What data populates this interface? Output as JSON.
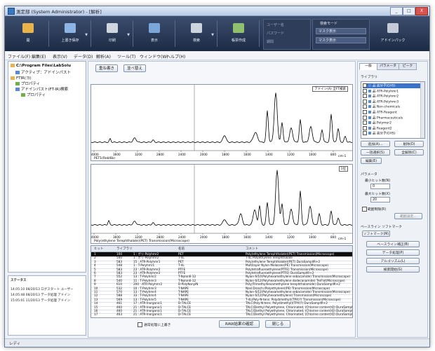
{
  "window": {
    "title": "測定部 (System Administrator) - [解析]",
    "minimize": "_",
    "maximize": "□",
    "close": "X"
  },
  "ribbon": {
    "buttons": [
      {
        "label": "開",
        "color": "#e8b34a",
        "icon": "folder-icon"
      },
      {
        "label": "上書き保存",
        "color": "#8db4e2",
        "icon": "save-icon"
      },
      {
        "label": "印刷",
        "color": "#cfd6e0",
        "icon": "print-icon"
      },
      {
        "label": "表示",
        "color": "#7aa6da",
        "icon": "view-icon"
      },
      {
        "label": "検索",
        "color": "#cdd4de",
        "icon": "search-icon"
      },
      {
        "label": "帳票作成",
        "color": "#8fc06e",
        "icon": "report-icon"
      }
    ],
    "panel1": {
      "line1": "ユーザー名",
      "line2": "パスワード",
      "line3": "期間"
    },
    "panel2": {
      "title": "検索モード",
      "drop1": "マスク表示",
      "drop2": "マスク表示"
    },
    "last": {
      "label": "アドインパック",
      "icon": "addin-icon"
    }
  },
  "menu": [
    "ファイル(F)",
    "編集(E)",
    "表示(V)",
    "データ(D)",
    "解析(A)",
    "ツール(T)",
    "ウィンドウ(W)",
    "ヘルプ(H)"
  ],
  "tree": [
    {
      "label": "C:\\Program Files\\LabSolu",
      "level": 0
    },
    {
      "label": "アクティブ：アドインパスト",
      "level": 1
    },
    {
      "label": "FTIR(ヨ)",
      "level": 0
    },
    {
      "label": "プロパティ",
      "level": 1
    },
    {
      "label": "アドインパスト(FT-IR)検索",
      "level": 1
    },
    {
      "label": "プロパティ",
      "level": 2
    }
  ],
  "log": {
    "header": "ステータス",
    "lines": [
      "14:05:10  08/20/13 ログスタート  ユーザー",
      "14:05:48  08/20/13 データ処理  アドイン",
      "15:05:01  11/20/13 データ処理  アドイン"
    ]
  },
  "status": {
    "text": "レディ"
  },
  "center": {
    "btn_search": "重ね書き",
    "btn_sort": "並べ替え",
    "plot1": {
      "label": "PET1(Rekl6b)",
      "legend": "アドイン(A) 全FT検索",
      "unit": "cm-1",
      "xticks": [
        "4000",
        "3600",
        "3200",
        "2800",
        "2400",
        "2000",
        "1800",
        "1600",
        "1400",
        "1200",
        "1000",
        "800"
      ]
    },
    "plot2": {
      "label": "Poly(ethylene Terephthalate)(PET) Transmission(Microscope)",
      "legend": "1位",
      "unit": "cm-1",
      "xticks": [
        "4000",
        "3600",
        "3200",
        "2800",
        "2400",
        "2000",
        "1800",
        "1600",
        "1400",
        "1200",
        "1000",
        "800"
      ]
    },
    "table": {
      "headers": [
        "ヒット",
        "ライブラリ",
        "",
        "名前",
        "コメント"
      ],
      "rows": [
        [
          "1",
          "100",
          "1 : ポリ-Polyhmr2",
          "PET",
          "Poly(ethylene Terephthalate)(PET) Transmission(Microscope)"
        ],
        [
          "2",
          "540",
          "1 : ポリ-Polyhmr2",
          "T-4L",
          "T-4L Polyethylene Terephthalate"
        ],
        [
          "3",
          "583",
          "15 : ATR-Polyhmr1",
          "PET",
          "Poly(ethylene Terephthalate)(PET) DuraSampllR+2"
        ],
        [
          "4",
          "548",
          "1 : T-Polyhmr1",
          "T-4L",
          "Multilayer Nylon Molasses(PE) Transmission(Microscope)"
        ],
        [
          "5",
          "583",
          "23 : ATR-Polyhmr2",
          "PTFE",
          "Polytetrafluoroethylene(PTFE) Transmission(Microscope)"
        ],
        [
          "6",
          "583",
          "23 : ATR-Polyhmr2",
          "PTFE",
          "Polytetrafluoroethylene(PTFE) DuraSampllR+2"
        ],
        [
          "7",
          "552",
          "13 : T-Polyhmr2",
          "T-Nylon6-12",
          "Nylon 6/10(Polyhexamethylene sebacamide) Transmission(Microscope)"
        ],
        [
          "8",
          "540",
          "11 : T-Polyhmr3",
          "T-Nylon6-12",
          "Nylon 6/12(Polyhexamethylene dodecanamide) TreFlot(Microscope)"
        ],
        [
          "9",
          "610",
          "200 : ATR-Polyhmr2",
          "D-PolyNonylN",
          "Poly(Trimethylhexamethylene terephthalamide) DuraSampllR+2"
        ],
        [
          "10",
          "532",
          "10 : T-Polyhmr3",
          "T-NAPE",
          "Nasl.Drosch.(Polyethylene)(PE) Transmission(Microscope)"
        ],
        [
          "11",
          "570",
          "13 : T-Polyhmr4",
          "T-NAPE",
          "Nylon 6/12(Polyhexamethylene sebacamide) Transmission(Microscope)"
        ],
        [
          "12",
          "588",
          "33 : T-Polyhmr4",
          "T-NAPE",
          "Nylon 6/12(Polyhexamethylene) Transmission(Microscope)"
        ],
        [
          "13",
          "569",
          "13 : T-Polyhmr5",
          "T-NAPE",
          "T-4L(Poly-N-tens. Polydimethyl)(TPX)?) Transmission(Microscope)"
        ],
        [
          "14",
          "461",
          "17 : ATR-Inorganic1",
          "D-ТАLCE",
          "TALC(Poly-N-tens. Polydimethyl)(TPX)?) DuraSampllR+2"
        ],
        [
          "15",
          "460",
          "21 : ATR-Inorganic1",
          "D-ТАLCE",
          "TALC(Diethyl Polyethylene, Chlorinated, (Chlorine content)Q) DuraSampllR+2"
        ],
        [
          "16",
          "460",
          "21 : ATR-Inorganic1",
          "D-ТАLCE",
          "TALC(Diethyl Polyethylene, Chlorinated, (Chlorine content)Q) DuraSampllR+2"
        ],
        [
          "17",
          "463",
          "21 : ATR-Inorganic1",
          "D-ТАLCE",
          "TALC(Diethyl Polyethylene, Chlorinated, (Chlorine content)Q) DuraSampllR+2"
        ]
      ]
    },
    "checkbox_label": "通常処理に上書き",
    "btn_register": "RAW結果の確認",
    "btn_close": "閉じる"
  },
  "right": {
    "tabs": [
      "一般",
      "パラメータ",
      "ピーク"
    ],
    "section1": "ライブラリ",
    "libraries": [
      "品 高分子(GHS)",
      "品 ATR-Polyhmr1",
      "品 ATR-Polyhmr2",
      "品 ATR-Polyhmr3",
      "品 Non-chemicals",
      "品 ATR-Reagent",
      "品 Pharmaceuticals",
      "品 Polymer2",
      "品 Reagent2",
      "品 高分子(GHS)"
    ],
    "btn_add": "追加(A)...",
    "btn_del": "削除(D)",
    "btn_all": "一括選択(S)",
    "btn_clear": "全解除(C)",
    "btn_edit": "編集(E)",
    "section2": "パラメータ",
    "label_min": "最小ヒット数(N)",
    "value_min": "0",
    "label_max": "最大ヒット数(X)",
    "value_max": "20",
    "check_label": "範囲制限(R)",
    "btn_range": "範囲設定...",
    "section3": "ベースライン ソフトマーク",
    "btn_base": "ソフトマーク(M)",
    "btn_b1": "ベースライン補正(B)",
    "btn_b2": "データ処理(P)",
    "btn_b3": "アルゴリズム(L)",
    "btn_b4": "検索開始(G)"
  }
}
